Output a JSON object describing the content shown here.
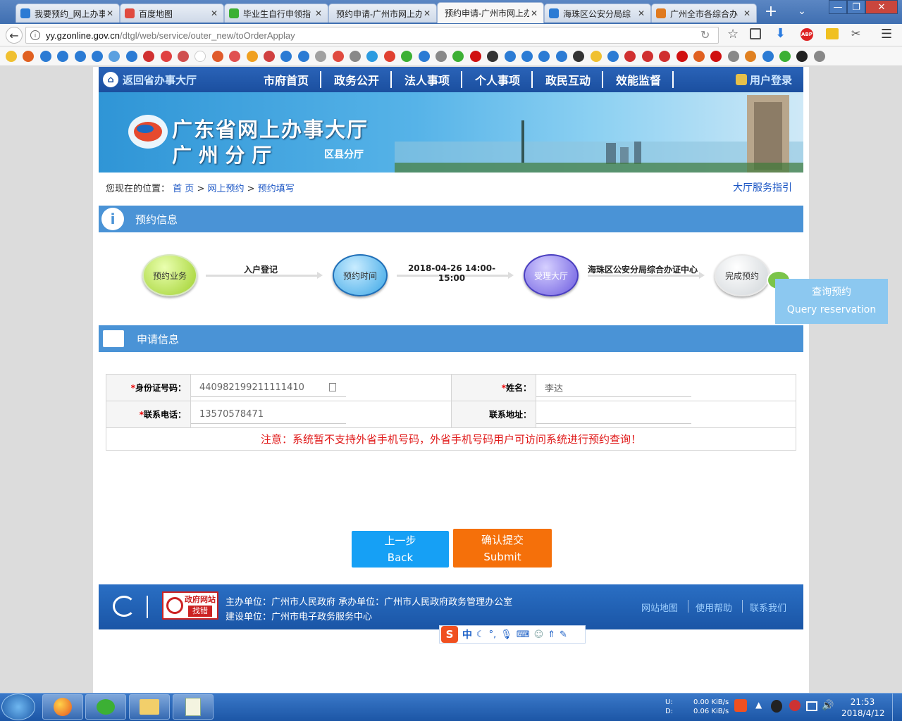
{
  "browser": {
    "tabs": [
      {
        "title": "我要预约_网上办事",
        "color": "#2b7bd4"
      },
      {
        "title": "百度地图",
        "color": "#e04a3f"
      },
      {
        "title": "毕业生自行申领指",
        "color": "#3cb034"
      },
      {
        "title": "预约申请-广州市网上办",
        "color": "#ffffff"
      },
      {
        "title": "预约申请-广州市网上办",
        "color": "#ffffff"
      },
      {
        "title": "海珠区公安分局综",
        "color": "#2b7bd4"
      },
      {
        "title": "广州全市各综合办",
        "color": "#e07a1f"
      }
    ],
    "new_tab": "+",
    "url": "yy.gzonline.gov.cn/dtgl/web/service/outer_new/toOrderApplay",
    "url_host": "yy.gzonline.gov.cn",
    "url_path": "/dtgl/web/service/outer_new/toOrderApplay"
  },
  "site": {
    "back_hall": "返回省办事大厅",
    "nav": [
      "市府首页",
      "政务公开",
      "法人事项",
      "个人事项",
      "政民互动",
      "效能监督"
    ],
    "login": "用户登录",
    "banner_title1": "广东省网上办事大厅",
    "banner_title2": "广 州 分 厅",
    "banner_sub": "区县分厅",
    "breadcrumb_prefix": "您现在的位置：",
    "breadcrumb": [
      "首 页",
      "网上预约",
      "预约填写"
    ],
    "breadcrumb_sep": ">",
    "service_guide": "大厅服务指引"
  },
  "booking": {
    "header": "预约信息",
    "steps": [
      "预约业务",
      "预约时间",
      "受理大厅",
      "完成预约"
    ],
    "step_values": [
      "入户登记",
      "2018-04-26 14:00-15:00",
      "海珠区公安分局综合办证中心"
    ]
  },
  "query_panel": {
    "zh": "查询预约",
    "en": "Query reservation"
  },
  "apply": {
    "header": "申请信息",
    "id_label": "身份证号码：",
    "id_value": "440982199211111410",
    "name_label": "姓名：",
    "name_value": "李达",
    "phone_label": "联系电话：",
    "phone_value": "13570578471",
    "address_label": "联系地址：",
    "address_value": "",
    "required_mark": "*",
    "notice": "注意：系统暂不支持外省手机号码，外省手机号码用户可访问系统进行预约查询！"
  },
  "buttons": {
    "back_zh": "上一步",
    "back_en": "Back",
    "submit_zh": "确认提交",
    "submit_en": "Submit"
  },
  "footer": {
    "badge_top": "政府网站",
    "badge_bottom": "找错",
    "line1": "主办单位：广州市人民政府 承办单位：广州市人民政府政务管理办公室",
    "line2": "建设单位：广州市电子政务服务中心",
    "links": [
      "网站地图",
      "使用帮助",
      "联系我们"
    ]
  },
  "ime": {
    "mode": "中"
  },
  "taskbar": {
    "net_u_label": "U:",
    "net_d_label": "D:",
    "net_u": "0.00 KiB/s",
    "net_d": "0.06 KiB/s",
    "time": "21:53",
    "date": "2018/4/12"
  }
}
